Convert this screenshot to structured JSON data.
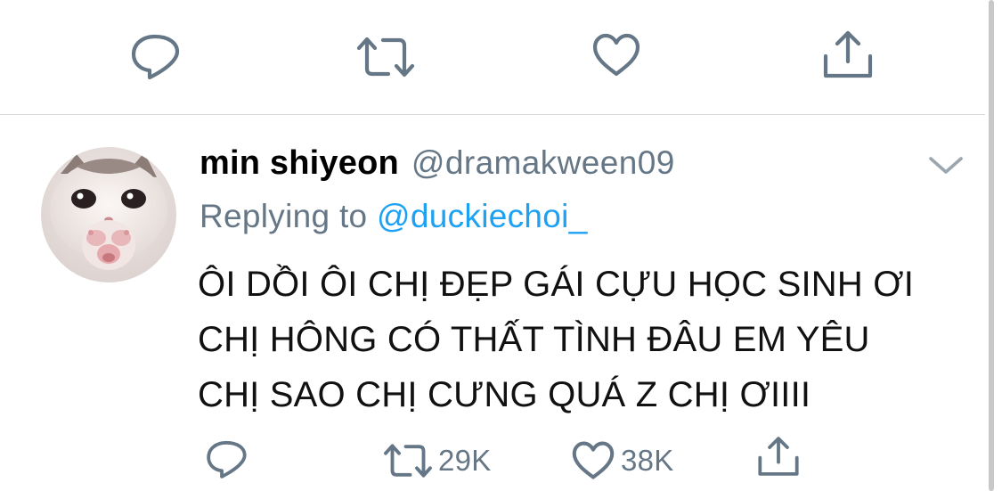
{
  "top_actions": {
    "reply_icon": "reply-icon",
    "retweet_icon": "retweet-icon",
    "like_icon": "heart-icon",
    "share_icon": "share-icon"
  },
  "tweet": {
    "display_name": "min shiyeon",
    "handle": "@dramakween09",
    "replying_prefix": "Replying to ",
    "replying_to": "@duckiechoi_",
    "text_lines": [
      "ÔI DỒI ÔI CHỊ ĐẸP GÁI CỰU HỌC SINH ƠI",
      "CHỊ HÔNG CÓ THẤT TÌNH ĐÂU EM YÊU",
      "CHỊ SAO CHỊ CƯNG QUÁ Z CHỊ ƠIIII"
    ],
    "retweet_count": "29K",
    "like_count": "38K"
  },
  "colors": {
    "secondary_text": "#657786",
    "link": "#1da1f2",
    "icon": "#657786"
  }
}
